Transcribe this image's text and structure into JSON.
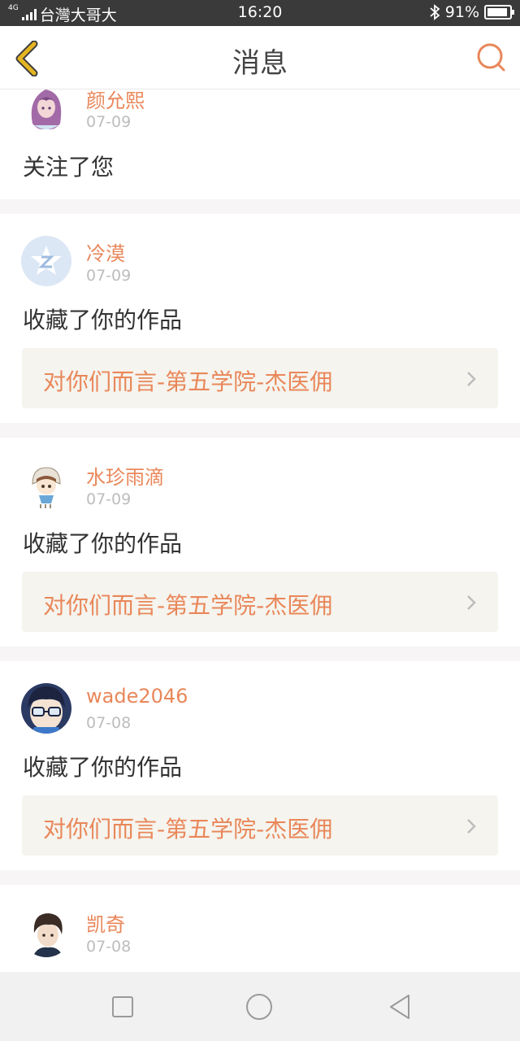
{
  "status_bar": {
    "network": "4G",
    "carrier": "台灣大哥大",
    "time": "16:20",
    "battery": "91%",
    "battery_level": 0.91,
    "icons": [
      "signal-icon",
      "bluetooth-icon",
      "battery-icon"
    ]
  },
  "header": {
    "title": "消息",
    "icons": [
      "back-chevron-icon",
      "search-icon"
    ]
  },
  "notifications": [
    {
      "user": "颜允熙",
      "date": "07-09",
      "action": "关注了您"
    },
    {
      "user": "冷漠",
      "date": "07-09",
      "action": "收藏了你的作品",
      "work": "对你们而言-第五学院-杰医佣"
    },
    {
      "user": "水珍雨滴",
      "date": "07-09",
      "action": "收藏了你的作品",
      "work": "对你们而言-第五学院-杰医佣"
    },
    {
      "user": "wade2046",
      "date": "07-08",
      "action": "收藏了你的作品",
      "work": "对你们而言-第五学院-杰医佣"
    },
    {
      "user": "凯奇",
      "date": "07-08"
    }
  ],
  "bottom_nav": {
    "icons": [
      "recent-apps-icon",
      "home-icon",
      "back-triangle-icon"
    ]
  },
  "colors": {
    "accent": "#e9875a",
    "back_arrow": "#e5b421",
    "work_bg": "#f5f4ee",
    "separator": "#f7f5f5"
  }
}
